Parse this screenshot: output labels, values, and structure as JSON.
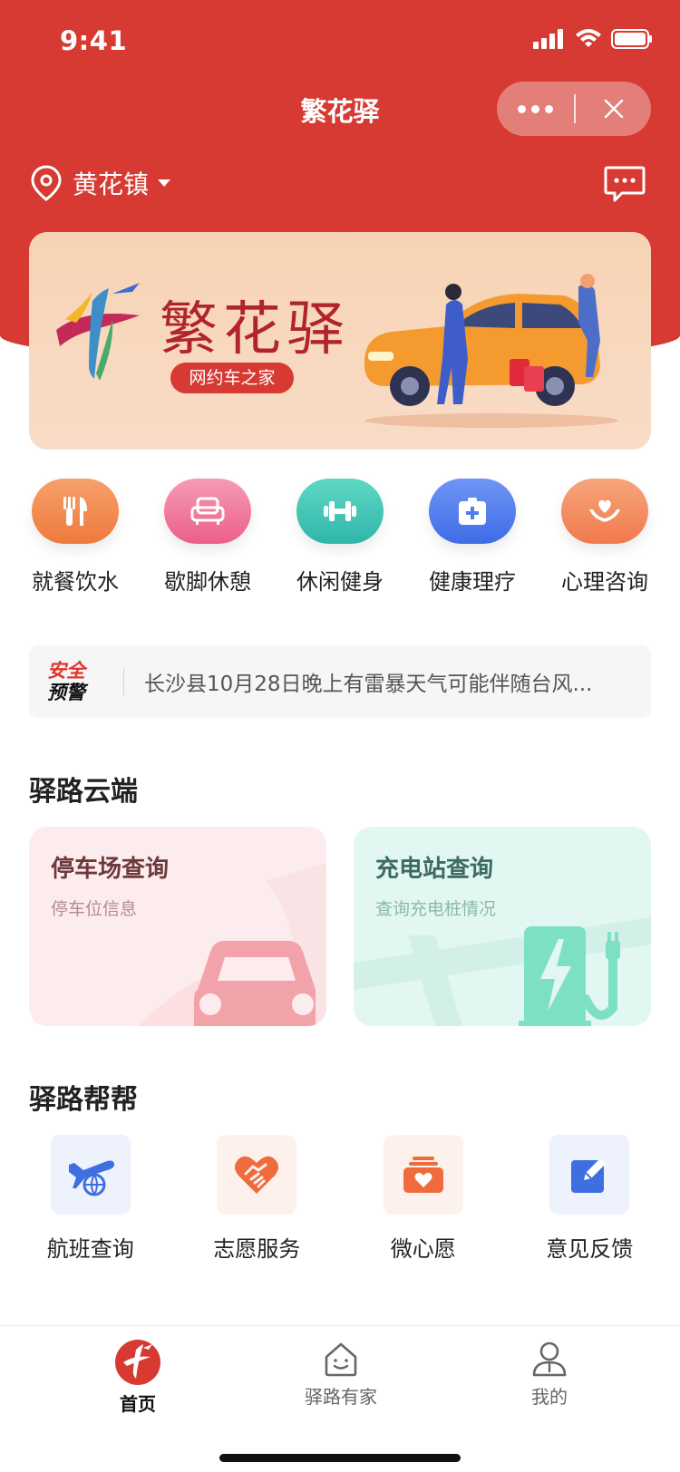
{
  "status_bar": {
    "time": "9:41"
  },
  "nav": {
    "title": "繁花驿"
  },
  "location": {
    "name": "黄花镇"
  },
  "banner": {
    "title": "繁花驿",
    "tag": "网约车之家"
  },
  "categories": [
    {
      "label": "就餐饮水",
      "icon": "utensils-icon",
      "color": "#f28a4b"
    },
    {
      "label": "歇脚休憩",
      "icon": "armchair-icon",
      "color": "#ef6e93"
    },
    {
      "label": "休闲健身",
      "icon": "dumbbell-icon",
      "color": "#40c9b8"
    },
    {
      "label": "健康理疗",
      "icon": "medical-kit-icon",
      "color": "#4f7df0"
    },
    {
      "label": "心理咨询",
      "icon": "heart-hand-icon",
      "color": "#f58e60"
    }
  ],
  "notice": {
    "badge_line1": "安全",
    "badge_line2": "预警",
    "text": "长沙县10月28日晚上有雷暴天气可能伴随台风..."
  },
  "cloud": {
    "title": "驿路云端",
    "parking": {
      "title": "停车场查询",
      "subtitle": "停车位信息"
    },
    "charging": {
      "title": "充电站查询",
      "subtitle": "查询充电桩情况"
    }
  },
  "help": {
    "title": "驿路帮帮",
    "items": [
      {
        "label": "航班查询",
        "icon": "plane-globe-icon"
      },
      {
        "label": "志愿服务",
        "icon": "handshake-heart-icon"
      },
      {
        "label": "微心愿",
        "icon": "wish-box-icon"
      },
      {
        "label": "意见反馈",
        "icon": "edit-feedback-icon"
      }
    ]
  },
  "tabbar": {
    "home": "首页",
    "family": "驿路有家",
    "mine": "我的"
  }
}
